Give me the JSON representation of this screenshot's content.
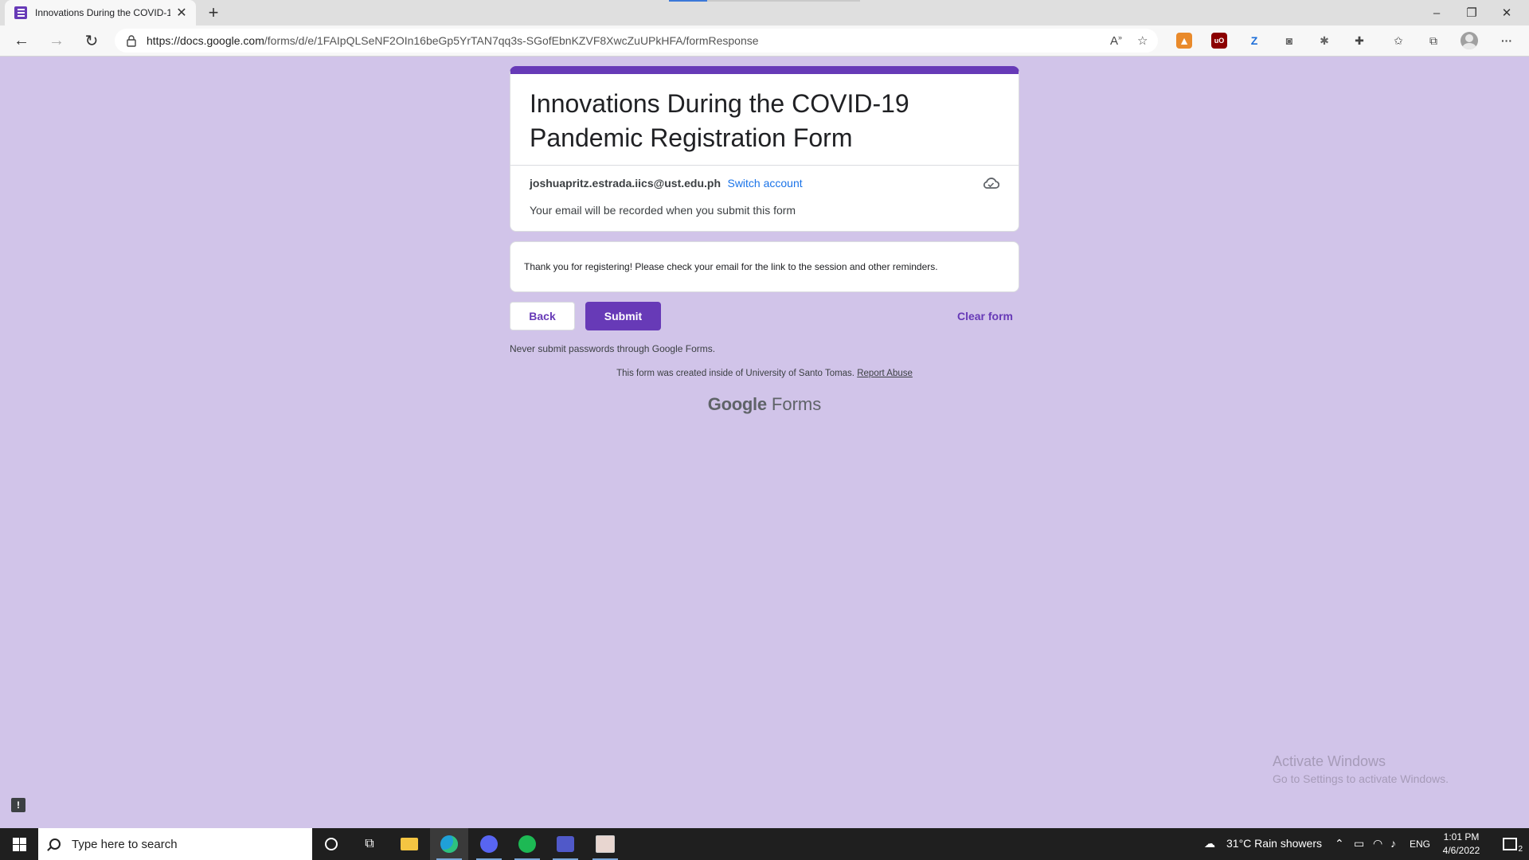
{
  "browser": {
    "tab_title": "Innovations During the COVID-1",
    "url_host": "https://docs.google.com",
    "url_path": "/forms/d/e/1FAIpQLSeNF2OIn16beGp5YrTAN7qq3s-SGofEbnKZVF8XwcZuUPkHFA/formResponse",
    "window_controls": [
      "–",
      "❐",
      "✕"
    ]
  },
  "form": {
    "accent_color": "#673ab7",
    "title": "Innovations During the COVID-19 Pandemic Registration Form",
    "account_email": "joshuapritz.estrada.iics@ust.edu.ph",
    "switch_account": "Switch account",
    "email_note": "Your email will be recorded when you submit this form",
    "message": "Thank you for registering! Please check your email for the link to the session and other reminders.",
    "back_label": "Back",
    "submit_label": "Submit",
    "clear_label": "Clear form",
    "never_note": "Never submit passwords through Google Forms.",
    "created_note": "This form was created inside of University of Santo Tomas.",
    "report_abuse": "Report Abuse",
    "logo_google": "Google",
    "logo_forms": "Forms"
  },
  "watermark": {
    "line1": "Activate Windows",
    "line2": "Go to Settings to activate Windows."
  },
  "taskbar": {
    "search_placeholder": "Type here to search",
    "weather": "31°C  Rain showers",
    "language": "ENG",
    "time": "1:01 PM",
    "date": "4/6/2022",
    "notification_count": "2"
  }
}
